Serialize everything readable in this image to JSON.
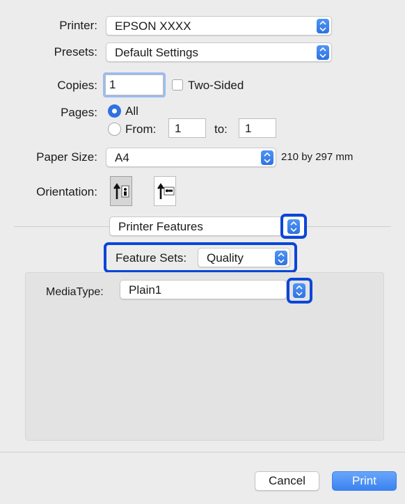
{
  "printer": {
    "label": "Printer:",
    "value": "EPSON XXXX"
  },
  "presets": {
    "label": "Presets:",
    "value": "Default Settings"
  },
  "copies": {
    "label": "Copies:",
    "value": "1",
    "two_sided_label": "Two-Sided",
    "two_sided_checked": false
  },
  "pages": {
    "label": "Pages:",
    "all_label": "All",
    "all_selected": true,
    "from_label": "From:",
    "from_value": "1",
    "to_label": "to:",
    "to_value": "1"
  },
  "paper_size": {
    "label": "Paper Size:",
    "value": "A4",
    "dimensions": "210 by 297 mm"
  },
  "orientation": {
    "label": "Orientation:",
    "options": [
      "portrait-icon",
      "landscape-icon"
    ],
    "selected": "portrait"
  },
  "section_menu": {
    "value": "Printer Features"
  },
  "feature_sets": {
    "label": "Feature Sets:",
    "value": "Quality"
  },
  "media_type": {
    "label": "MediaType:",
    "value": "Plain1"
  },
  "buttons": {
    "cancel": "Cancel",
    "print": "Print"
  },
  "colors": {
    "accent": "#2f72e0",
    "highlight": "#0a46d8",
    "background": "#ececec"
  }
}
